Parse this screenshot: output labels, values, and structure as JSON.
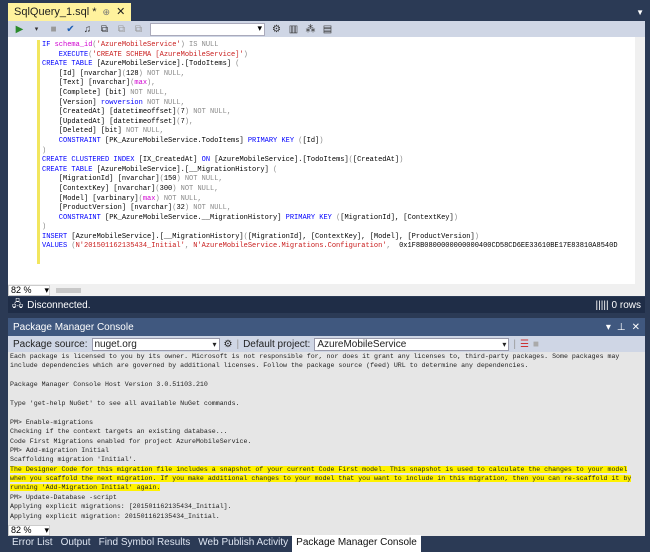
{
  "document_tab": {
    "title": "SqlQuery_1.sql *",
    "pin": "⊕",
    "close": "✕"
  },
  "editor": {
    "zoom": "82 %",
    "lines": [
      [
        {
          "t": "IF ",
          "k": "kw"
        },
        {
          "t": "schema_id",
          "k": "fn"
        },
        {
          "t": "(",
          "k": "gray"
        },
        {
          "t": "'AzureMobileService'",
          "k": "str"
        },
        {
          "t": ") ",
          "k": "gray"
        },
        {
          "t": "IS NULL",
          "k": "gray"
        }
      ],
      [
        {
          "t": "    EXECUTE",
          "k": "kw"
        },
        {
          "t": "(",
          "k": "gray"
        },
        {
          "t": "'CREATE SCHEMA [AzureMobileService]'",
          "k": "str"
        },
        {
          "t": ")",
          "k": "gray"
        }
      ],
      [
        {
          "t": "CREATE TABLE ",
          "k": "kw"
        },
        {
          "t": "[AzureMobileService].[TodoItems] ",
          "k": "txt"
        },
        {
          "t": "(",
          "k": "gray"
        }
      ],
      [
        {
          "t": "    [Id] [nvarchar]",
          "k": "txt"
        },
        {
          "t": "(",
          "k": "gray"
        },
        {
          "t": "128",
          "k": "txt"
        },
        {
          "t": ") NOT NULL,",
          "k": "gray"
        }
      ],
      [
        {
          "t": "    [Text] [nvarchar]",
          "k": "txt"
        },
        {
          "t": "(",
          "k": "gray"
        },
        {
          "t": "max",
          "k": "fn"
        },
        {
          "t": "),",
          "k": "gray"
        }
      ],
      [
        {
          "t": "    [Complete] [bit] ",
          "k": "txt"
        },
        {
          "t": "NOT NULL,",
          "k": "gray"
        }
      ],
      [
        {
          "t": "    [Version] ",
          "k": "txt"
        },
        {
          "t": "rowversion ",
          "k": "kw"
        },
        {
          "t": "NOT NULL,",
          "k": "gray"
        }
      ],
      [
        {
          "t": "    [CreatedAt] [datetimeoffset]",
          "k": "txt"
        },
        {
          "t": "(",
          "k": "gray"
        },
        {
          "t": "7",
          "k": "txt"
        },
        {
          "t": ") NOT NULL,",
          "k": "gray"
        }
      ],
      [
        {
          "t": "    [UpdatedAt] [datetimeoffset]",
          "k": "txt"
        },
        {
          "t": "(",
          "k": "gray"
        },
        {
          "t": "7",
          "k": "txt"
        },
        {
          "t": "),",
          "k": "gray"
        }
      ],
      [
        {
          "t": "    [Deleted] [bit] ",
          "k": "txt"
        },
        {
          "t": "NOT NULL,",
          "k": "gray"
        }
      ],
      [
        {
          "t": "    CONSTRAINT ",
          "k": "kw"
        },
        {
          "t": "[PK_AzureMobileService.TodoItems] ",
          "k": "txt"
        },
        {
          "t": "PRIMARY KEY ",
          "k": "kw"
        },
        {
          "t": "(",
          "k": "gray"
        },
        {
          "t": "[Id]",
          "k": "txt"
        },
        {
          "t": ")",
          "k": "gray"
        }
      ],
      [
        {
          "t": ")",
          "k": "gray"
        }
      ],
      [
        {
          "t": "CREATE CLUSTERED INDEX ",
          "k": "kw"
        },
        {
          "t": "[IX_CreatedAt] ",
          "k": "txt"
        },
        {
          "t": "ON ",
          "k": "kw"
        },
        {
          "t": "[AzureMobileService].[TodoItems]",
          "k": "txt"
        },
        {
          "t": "(",
          "k": "gray"
        },
        {
          "t": "[CreatedAt]",
          "k": "txt"
        },
        {
          "t": ")",
          "k": "gray"
        }
      ],
      [
        {
          "t": "CREATE TABLE ",
          "k": "kw"
        },
        {
          "t": "[AzureMobileService].[__MigrationHistory] ",
          "k": "txt"
        },
        {
          "t": "(",
          "k": "gray"
        }
      ],
      [
        {
          "t": "    [MigrationId] [nvarchar]",
          "k": "txt"
        },
        {
          "t": "(",
          "k": "gray"
        },
        {
          "t": "150",
          "k": "txt"
        },
        {
          "t": ") NOT NULL,",
          "k": "gray"
        }
      ],
      [
        {
          "t": "    [ContextKey] [nvarchar]",
          "k": "txt"
        },
        {
          "t": "(",
          "k": "gray"
        },
        {
          "t": "300",
          "k": "txt"
        },
        {
          "t": ") NOT NULL,",
          "k": "gray"
        }
      ],
      [
        {
          "t": "    [Model] [varbinary]",
          "k": "txt"
        },
        {
          "t": "(",
          "k": "gray"
        },
        {
          "t": "max",
          "k": "fn"
        },
        {
          "t": ") NOT NULL,",
          "k": "gray"
        }
      ],
      [
        {
          "t": "    [ProductVersion] [nvarchar]",
          "k": "txt"
        },
        {
          "t": "(",
          "k": "gray"
        },
        {
          "t": "32",
          "k": "txt"
        },
        {
          "t": ") NOT NULL,",
          "k": "gray"
        }
      ],
      [
        {
          "t": "    CONSTRAINT ",
          "k": "kw"
        },
        {
          "t": "[PK_AzureMobileService.__MigrationHistory] ",
          "k": "txt"
        },
        {
          "t": "PRIMARY KEY ",
          "k": "kw"
        },
        {
          "t": "(",
          "k": "gray"
        },
        {
          "t": "[MigrationId], [ContextKey]",
          "k": "txt"
        },
        {
          "t": ")",
          "k": "gray"
        }
      ],
      [
        {
          "t": ")",
          "k": "gray"
        }
      ],
      [
        {
          "t": "INSERT ",
          "k": "kw"
        },
        {
          "t": "[AzureMobileService].[__MigrationHistory]",
          "k": "txt"
        },
        {
          "t": "(",
          "k": "gray"
        },
        {
          "t": "[MigrationId], [ContextKey], [Model], [ProductVersion]",
          "k": "txt"
        },
        {
          "t": ")",
          "k": "gray"
        }
      ],
      [
        {
          "t": "VALUES ",
          "k": "kw"
        },
        {
          "t": "(",
          "k": "gray"
        },
        {
          "t": "N'201501162135434_Initial'",
          "k": "str"
        },
        {
          "t": ", ",
          "k": "gray"
        },
        {
          "t": "N'AzureMobileService.Migrations.Configuration'",
          "k": "str"
        },
        {
          "t": ",  ",
          "k": "gray"
        },
        {
          "t": "0x1F8B0800000000000400CD58CD6EE33610BE17E83810A8540D",
          "k": "txt"
        }
      ]
    ]
  },
  "status": {
    "text": "Disconnected.",
    "rows": "0 rows"
  },
  "pmc": {
    "title": "Package Manager Console",
    "source_label": "Package source:",
    "source_value": "nuget.org",
    "project_label": "Default project:",
    "project_value": "AzureMobileService",
    "zoom": "82 %",
    "lines": [
      {
        "t": "Each package is licensed to you by its owner. Microsoft is not responsible for, nor does it grant any licenses to, third-party packages. Some packages may",
        "hl": false
      },
      {
        "t": "include dependencies which are governed by additional licenses. Follow the package source (feed) URL to determine any dependencies.",
        "hl": false
      },
      {
        "t": "",
        "hl": false
      },
      {
        "t": "Package Manager Console Host Version 3.0.51103.210",
        "hl": false
      },
      {
        "t": "",
        "hl": false
      },
      {
        "t": "Type 'get-help NuGet' to see all available NuGet commands.",
        "hl": false
      },
      {
        "t": "",
        "hl": false
      },
      {
        "t": "PM> Enable-migrations",
        "hl": false
      },
      {
        "t": "Checking if the context targets an existing database...",
        "hl": false
      },
      {
        "t": "Code First Migrations enabled for project AzureMobileService.",
        "hl": false
      },
      {
        "t": "PM> Add-migration Initial",
        "hl": false
      },
      {
        "t": "Scaffolding migration 'Initial'.",
        "hl": false
      },
      {
        "t": "The Designer Code for this migration file includes a snapshot of your current Code First model. This snapshot is used to calculate the changes to your model",
        "hl": true
      },
      {
        "t": "when you scaffold the next migration. If you make additional changes to your model that you want to include in this migration, then you can re-scaffold it by",
        "hl": true
      },
      {
        "t": "running 'Add-Migration Initial' again.",
        "hl": true
      },
      {
        "t": "PM> Update-Database -script",
        "hl": false
      },
      {
        "t": "Applying explicit migrations: [201501162135434_Initial].",
        "hl": false
      },
      {
        "t": "Applying explicit migration: 201501162135434_Initial.",
        "hl": false
      }
    ]
  },
  "bottom_tabs": [
    {
      "label": "Error List",
      "active": false
    },
    {
      "label": "Output",
      "active": false
    },
    {
      "label": "Find Symbol Results",
      "active": false
    },
    {
      "label": "Web Publish Activity",
      "active": false
    },
    {
      "label": "Package Manager Console",
      "active": true
    }
  ]
}
